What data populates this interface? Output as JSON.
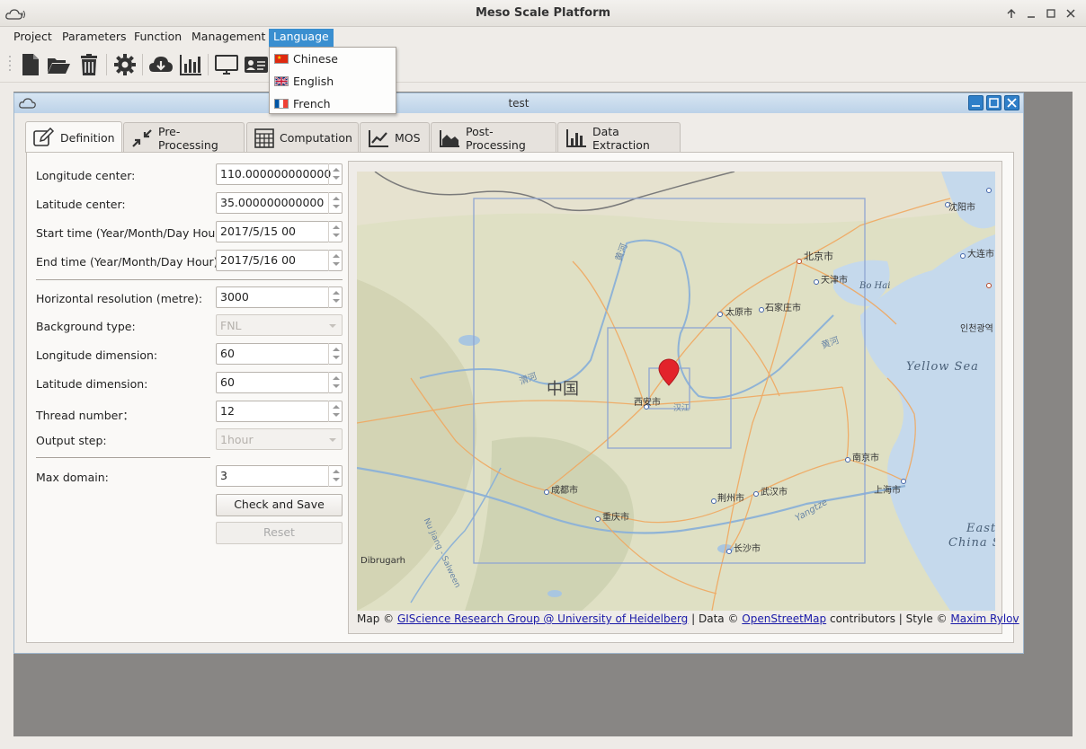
{
  "app": {
    "title": "Meso Scale Platform"
  },
  "menu": {
    "items": [
      "Project",
      "Parameters",
      "Function",
      "Management",
      "Language"
    ]
  },
  "language_menu": {
    "items": [
      "Chinese",
      "English",
      "French"
    ]
  },
  "child": {
    "title": "test"
  },
  "tabs": [
    "Definition",
    "Pre-Processing",
    "Computation",
    "MOS",
    "Post-Processing",
    "Data Extraction"
  ],
  "form": {
    "lon_center_label": "Longitude center:",
    "lon_center_value": "110.000000000000",
    "lat_center_label": "Latitude center:",
    "lat_center_value": "35.000000000000",
    "start_label": "Start time (Year/Month/Day Hour):",
    "start_value": "2017/5/15 00",
    "end_label": "End time (Year/Month/Day Hour):",
    "end_value": "2017/5/16 00",
    "hres_label": "Horizontal resolution (metre):",
    "hres_value": "3000",
    "bg_label": "Background type:",
    "bg_value": "FNL",
    "londim_label": "Longitude dimension:",
    "londim_value": "60",
    "latdim_label": "Latitude dimension:",
    "latdim_value": "60",
    "thread_label": "Thread number：",
    "thread_value": "12",
    "output_label": "Output step:",
    "output_value": "1hour",
    "maxdom_label": "Max domain:",
    "maxdom_value": "3",
    "check_save": "Check and Save",
    "reset": "Reset"
  },
  "map": {
    "labels": {
      "beijing": "北京市",
      "tianjin": "天津市",
      "taiyuan": "太原市",
      "shijiazhuang": "石家庄市",
      "xian": "西安市",
      "zhongguo": "中国",
      "chengdu": "成都市",
      "chongqing": "重庆市",
      "jingzhou": "荆州市",
      "wuhan": "武汉市",
      "changsha": "长沙市",
      "nanjing": "南京市",
      "shanghai": "上海市",
      "shenyang": "沈阳市",
      "dalian": "大连市",
      "incheon": "인천광역",
      "bohai": "Bo Hai",
      "yellow_sea": "Yellow Sea",
      "east_china_1": "East",
      "east_china_2": "China S",
      "dibrugarh": "Dibrugarh",
      "yangtze": "Yangtze",
      "huanghe1": "黄河",
      "huanghe2": "黄河",
      "weihe": "渭河",
      "nu": "Nu Jiang - Salween",
      "han": "汉江"
    },
    "attribution": {
      "prefix": "Map ©",
      "link1": "GIScience Research Group @ University of Heidelberg",
      "mid1": "| Data ©",
      "link2": "OpenStreetMap",
      "mid2": "contributors | Style ©",
      "link3": "Maxim Rylov"
    }
  },
  "colors": {
    "accent": "#3a8fd0",
    "marker": "#e3232b",
    "water": "#c5d9ec",
    "road": "#f0a860"
  }
}
